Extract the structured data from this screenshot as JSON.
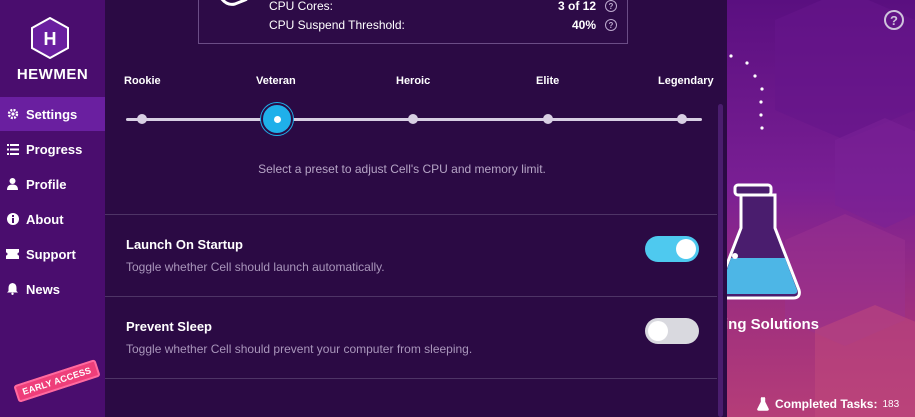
{
  "brand": {
    "name": "HEWMEN",
    "letter": "H",
    "badge": "EARLY ACCESS"
  },
  "nav": [
    {
      "label": "Settings",
      "icon": "gear-icon",
      "active": true
    },
    {
      "label": "Progress",
      "icon": "list-icon"
    },
    {
      "label": "Profile",
      "icon": "user-icon"
    },
    {
      "label": "About",
      "icon": "info-icon"
    },
    {
      "label": "Support",
      "icon": "ticket-icon"
    },
    {
      "label": "News",
      "icon": "bell-icon"
    }
  ],
  "cpu": {
    "cores_label": "CPU Cores:",
    "cores_value": "3 of 12",
    "threshold_label": "CPU Suspend Threshold:",
    "threshold_value": "40%"
  },
  "presets": {
    "labels": [
      "Rookie",
      "Veteran",
      "Heroic",
      "Elite",
      "Legendary"
    ],
    "selected": "Veteran",
    "description": "Select a preset to adjust Cell's CPU and memory limit."
  },
  "settings": {
    "startup": {
      "title": "Launch On Startup",
      "desc": "Toggle whether Cell should launch automatically.",
      "enabled": true
    },
    "sleep": {
      "title": "Prevent Sleep",
      "desc": "Toggle whether Cell should prevent your computer from sleeping.",
      "enabled": false
    }
  },
  "right": {
    "heading_fragment": "ing Solutions",
    "completed_label": "Completed Tasks:",
    "completed_value": "183"
  },
  "colors": {
    "accent": "#1fb0ea",
    "toggle_on": "#4ec9ef",
    "sidebar": "#4a0d6e",
    "panel": "#2b0a44",
    "badge": "#ee3e7a"
  }
}
